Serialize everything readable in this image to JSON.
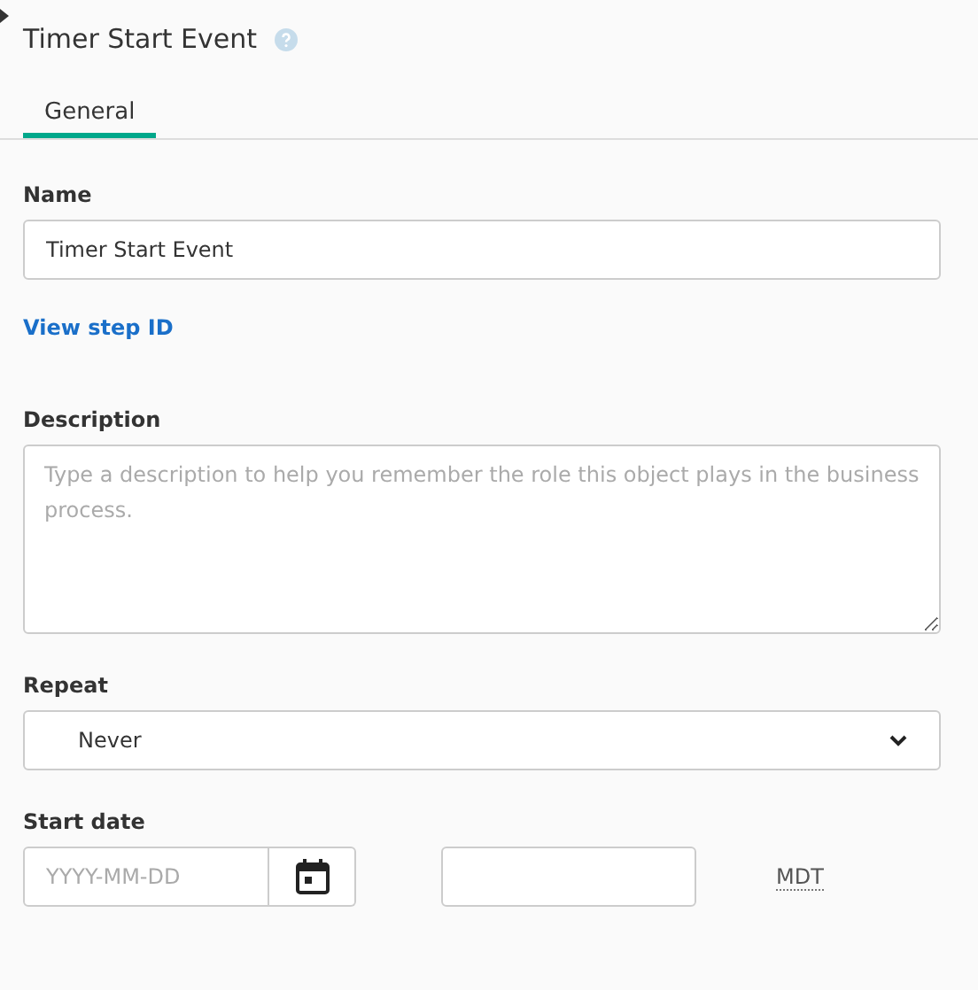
{
  "panel": {
    "title": "Timer Start Event"
  },
  "tabs": [
    {
      "label": "General",
      "selected": true
    }
  ],
  "name": {
    "label": "Name",
    "value": "Timer Start Event"
  },
  "step_link": "View step ID",
  "description": {
    "label": "Description",
    "placeholder": "Type a description to help you remember the role this object plays in the business process."
  },
  "repeat": {
    "label": "Repeat",
    "value": "Never"
  },
  "start_date": {
    "label": "Start date",
    "date_placeholder": "YYYY-MM-DD",
    "timezone": "MDT"
  }
}
